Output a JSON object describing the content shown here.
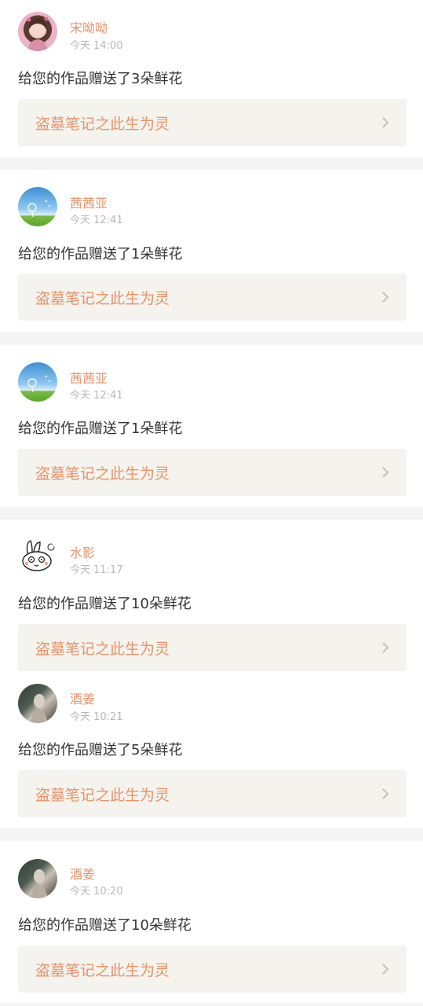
{
  "items": [
    {
      "user": "宋呦呦",
      "time": "今天 14:00",
      "message": "给您的作品赠送了3朵鲜花",
      "work": "盗墓笔记之此生为灵",
      "avatar_icon": "girl-portrait-avatar"
    },
    {
      "user": "茜茜亚",
      "time": "今天 12:41",
      "message": "给您的作品赠送了1朵鲜花",
      "work": "盗墓笔记之此生为灵",
      "avatar_icon": "dandelion-sky-avatar"
    },
    {
      "user": "茜茜亚",
      "time": "今天 12:41",
      "message": "给您的作品赠送了1朵鲜花",
      "work": "盗墓笔记之此生为灵",
      "avatar_icon": "dandelion-sky-avatar"
    },
    {
      "user": "水影",
      "time": "今天 11:17",
      "message": "给您的作品赠送了10朵鲜花",
      "work": "盗墓笔记之此生为灵",
      "avatar_icon": "rabbit-sketch-avatar"
    },
    {
      "user": "酒姜",
      "time": "今天 10:21",
      "message": "给您的作品赠送了5朵鲜花",
      "work": "盗墓笔记之此生为灵",
      "avatar_icon": "photo-avatar"
    },
    {
      "user": "酒姜",
      "time": "今天 10:20",
      "message": "给您的作品赠送了10朵鲜花",
      "work": "盗墓笔记之此生为灵",
      "avatar_icon": "photo-avatar"
    }
  ],
  "colors": {
    "accent": "#e8936a",
    "card_bg": "#f4f3ed",
    "separator": "#f5f5f5",
    "timestamp": "#b8b8b8",
    "text": "#333333"
  }
}
